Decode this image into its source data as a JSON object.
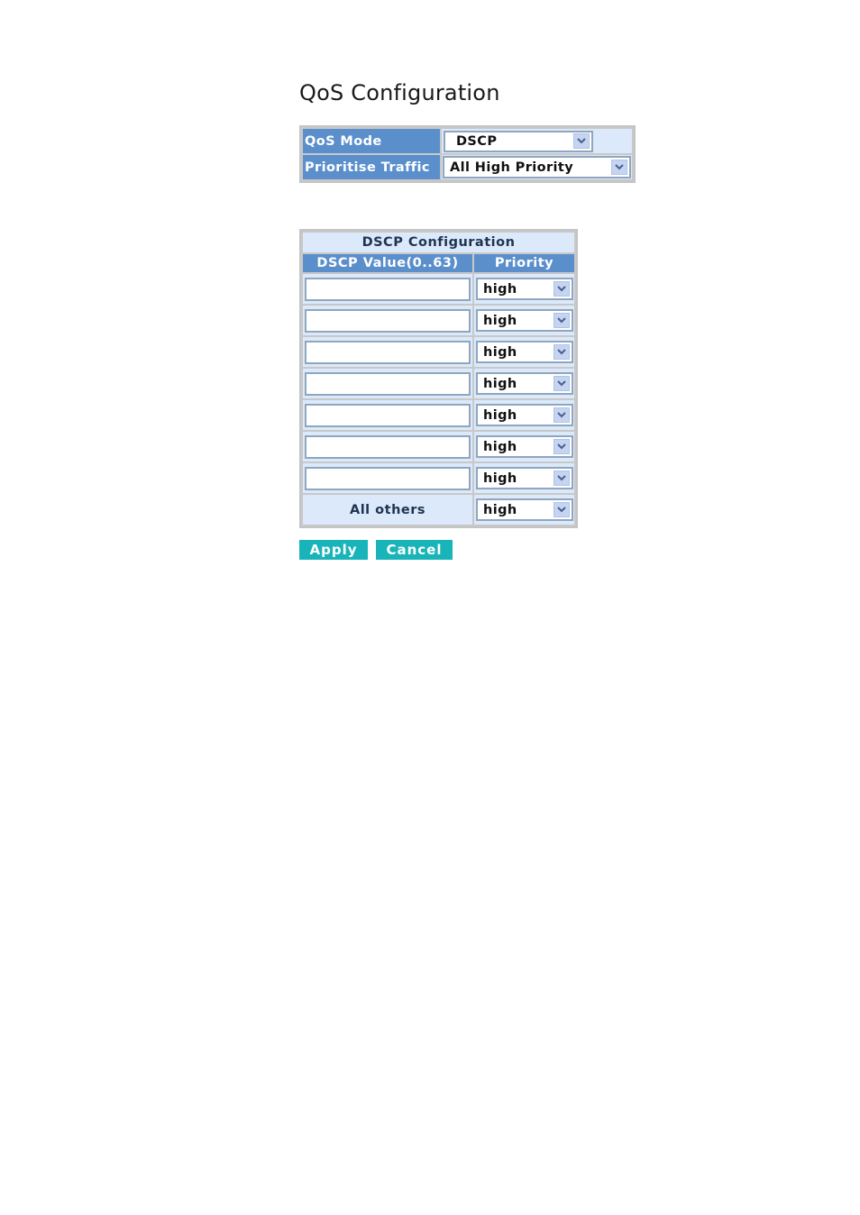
{
  "page": {
    "title": "QoS Configuration"
  },
  "qos": {
    "mode_label": "QoS Mode",
    "mode_value": "DSCP",
    "traffic_label": "Prioritise Traffic",
    "traffic_value": "All High Priority"
  },
  "dscp": {
    "caption": "DSCP Configuration",
    "headers": {
      "value": "DSCP Value(0..63)",
      "priority": "Priority"
    },
    "rows": [
      {
        "value": "",
        "priority": "high"
      },
      {
        "value": "",
        "priority": "high"
      },
      {
        "value": "",
        "priority": "high"
      },
      {
        "value": "",
        "priority": "high"
      },
      {
        "value": "",
        "priority": "high"
      },
      {
        "value": "",
        "priority": "high"
      },
      {
        "value": "",
        "priority": "high"
      }
    ],
    "others": {
      "label": "All others",
      "priority": "high"
    }
  },
  "buttons": {
    "apply": "Apply",
    "cancel": "Cancel"
  },
  "icons": {
    "dropdown": "chevron-down-icon"
  },
  "colors": {
    "header_blue": "#5b8fcc",
    "cell_light_blue": "#dbe9fb",
    "button_teal": "#19b4b9",
    "dropdown_arrow_bg": "#c5d4f1"
  }
}
